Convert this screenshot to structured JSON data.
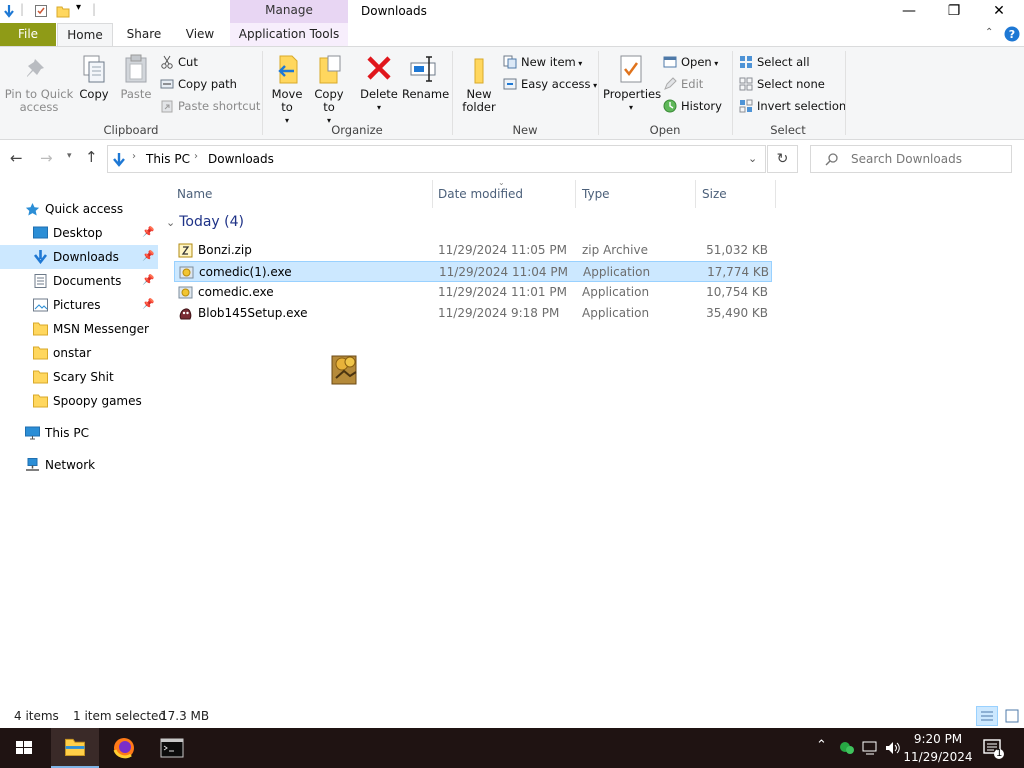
{
  "window": {
    "title": "Downloads",
    "contextual_tab_group": "Manage",
    "controls": {
      "minimize": "—",
      "restore": "❐",
      "close": "✕"
    }
  },
  "ribbon_tabs": {
    "file": "File",
    "home": "Home",
    "share": "Share",
    "view": "View",
    "app_tools": "Application Tools"
  },
  "ribbon": {
    "clipboard": {
      "label": "Clipboard",
      "pin": "Pin to Quick access",
      "copy": "Copy",
      "paste": "Paste",
      "cut": "Cut",
      "copy_path": "Copy path",
      "paste_shortcut": "Paste shortcut"
    },
    "organize": {
      "label": "Organize",
      "move_to": "Move to",
      "copy_to": "Copy to",
      "delete": "Delete",
      "rename": "Rename"
    },
    "new": {
      "label": "New",
      "new_folder": "New folder",
      "new_item": "New item",
      "easy_access": "Easy access"
    },
    "open": {
      "label": "Open",
      "properties": "Properties",
      "open": "Open",
      "edit": "Edit",
      "history": "History"
    },
    "select": {
      "label": "Select",
      "select_all": "Select all",
      "select_none": "Select none",
      "invert": "Invert selection"
    }
  },
  "address": {
    "crumbs": [
      "This PC",
      "Downloads"
    ],
    "search_placeholder": "Search Downloads"
  },
  "nav": {
    "quick_access": "Quick access",
    "items": [
      {
        "label": "Desktop",
        "pinned": true
      },
      {
        "label": "Downloads",
        "pinned": true
      },
      {
        "label": "Documents",
        "pinned": true
      },
      {
        "label": "Pictures",
        "pinned": true
      },
      {
        "label": "MSN Messenger",
        "pinned": false
      },
      {
        "label": "onstar",
        "pinned": false
      },
      {
        "label": "Scary Shit",
        "pinned": false
      },
      {
        "label": "Spoopy games",
        "pinned": false
      }
    ],
    "this_pc": "This PC",
    "network": "Network"
  },
  "columns": {
    "name": "Name",
    "date": "Date modified",
    "type": "Type",
    "size": "Size"
  },
  "group": {
    "label": "Today (4)"
  },
  "files": [
    {
      "name": "Bonzi.zip",
      "date": "11/29/2024 11:05 PM",
      "type": "zip Archive",
      "size": "51,032 KB",
      "selected": false
    },
    {
      "name": "comedic(1).exe",
      "date": "11/29/2024 11:04 PM",
      "type": "Application",
      "size": "17,774 KB",
      "selected": true
    },
    {
      "name": "comedic.exe",
      "date": "11/29/2024 11:01 PM",
      "type": "Application",
      "size": "10,754 KB",
      "selected": false
    },
    {
      "name": "Blob145Setup.exe",
      "date": "11/29/2024 9:18 PM",
      "type": "Application",
      "size": "35,490 KB",
      "selected": false
    }
  ],
  "status": {
    "count": "4 items",
    "selection": "1 item selected",
    "size": "17.3 MB"
  },
  "taskbar": {
    "time": "9:20 PM",
    "date": "11/29/2024",
    "notifications": "1"
  },
  "colors": {
    "accent_select": "#cce8ff",
    "file_tab": "#8f9b17",
    "manage_tab": "#e8d6f3",
    "taskbar": "#1f1312"
  }
}
